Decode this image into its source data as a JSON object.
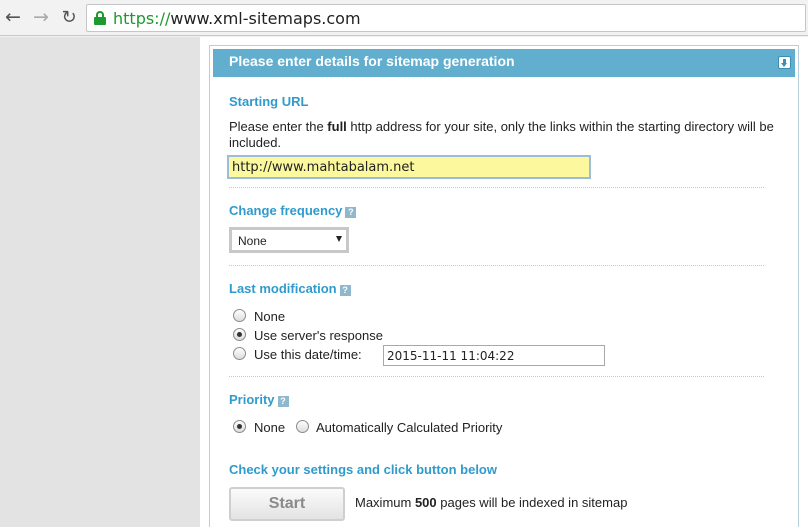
{
  "browser": {
    "back_icon": "arrow-left-icon",
    "forward_icon": "arrow-right-icon",
    "reload_icon": "reload-icon",
    "lock_icon": "lock-icon",
    "url_scheme": "https://",
    "url_rest": "www.xml-sitemaps.com"
  },
  "panel": {
    "title": "Please enter details for sitemap generation",
    "collapse_icon": "collapse-icon"
  },
  "starting_url": {
    "title": "Starting URL",
    "desc_before": "Please enter the ",
    "desc_bold": "full",
    "desc_after": " http address for your site, only the links within the starting directory will be included.",
    "value": "http://www.mahtabalam.net"
  },
  "change_frequency": {
    "title": "Change frequency",
    "help": "?",
    "selected": "None"
  },
  "last_modification": {
    "title": "Last modification",
    "help": "?",
    "options": [
      "None",
      "Use server's response",
      "Use this date/time:"
    ],
    "selected_index": 1,
    "datetime_value": "2015-11-11 11:04:22"
  },
  "priority": {
    "title": "Priority",
    "help": "?",
    "options": [
      "None",
      "Automatically Calculated Priority"
    ],
    "selected_index": 0
  },
  "submit": {
    "title": "Check your settings and click button below",
    "button_label": "Start",
    "info_before": "Maximum ",
    "info_bold": "500",
    "info_after": " pages will be indexed in sitemap"
  },
  "colors": {
    "accent": "#2f9bcc",
    "header_bg": "#62aece",
    "secure_green": "#1d9a2d",
    "input_highlight": "#fbf89e"
  }
}
